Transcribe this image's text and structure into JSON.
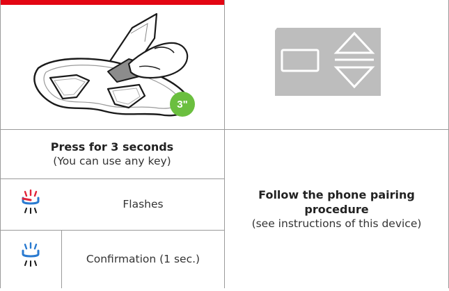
{
  "colors": {
    "accent_red": "#e30613",
    "timer_green": "#6bbf3f",
    "led_red": "#e2233a",
    "led_blue": "#2a7ad0",
    "screen_gray": "#bdbdbd"
  },
  "illustration": {
    "device": "intercom-device-illustration",
    "finger": "pressing-finger-icon",
    "timer_badge": "3\""
  },
  "display_icons": [
    "rectangle-icon",
    "up-down-arrow-icon"
  ],
  "instruction": {
    "title": "Press for 3 seconds",
    "subtitle": "(You can use any key)"
  },
  "rows": [
    {
      "icon": "led-flashing-red-blue-icon",
      "label": "Flashes"
    },
    {
      "icon": "led-blue-icon",
      "label": "Confirmation (1 sec.)"
    }
  ],
  "phone": {
    "title": "Follow the phone pairing procedure",
    "subtitle": "(see instructions of this device)"
  }
}
